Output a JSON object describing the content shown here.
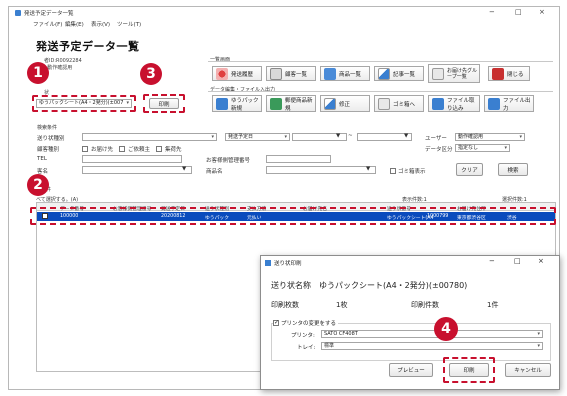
{
  "window": {
    "title": "発送予定データ一覧",
    "minimize": "−",
    "maximize": "□",
    "close": "×"
  },
  "menu": [
    "ファイル(F)",
    "編集(E)",
    "表示(V)",
    "ツール(T)"
  ],
  "page_title": "発送予定データ一覧",
  "user_info": {
    "line1": "者ID:R0092284",
    "line2": ": 動作確認用"
  },
  "invoice_select": {
    "caption": "状",
    "value": "ゆうパックシート(A4・2発分)(±007"
  },
  "print_button": "印刷",
  "list_screen": {
    "caption": "一覧画面",
    "buttons": [
      "発送履歴",
      "顧客一覧",
      "商品一覧",
      "記事一覧",
      "お届け先グループ一覧",
      "閉じる"
    ]
  },
  "data_edit": {
    "caption": "データ編集・ファイル入出力",
    "buttons": [
      "ゆうパック新規",
      "郵便商品新規",
      "修正",
      "ゴミ箱へ",
      "ファイル取り込み",
      "ファイル出力"
    ]
  },
  "search": {
    "caption": "検索条件",
    "invoice_type_label": "送り状種別",
    "date_label": "発送予定日",
    "tilde": "~",
    "user_label": "ユーザー",
    "user_value": "動作確認用",
    "customer_type_label": "顧客種別",
    "checks": [
      "お届け先",
      "ご依頼主",
      "集荷先"
    ],
    "data_class_label": "データ区分",
    "data_class_value": "指定なし",
    "tel_label": "TEL",
    "mgmt_no_label": "お客様側管理番号",
    "name_label": "客名",
    "product_label": "商品名",
    "trash_check": "ゴミ箱表示",
    "clear_button": "クリア",
    "search_button": "検索"
  },
  "results": {
    "caption": "送条件",
    "select_all": "べて選択する。(A)",
    "display_count": "表示件数:1",
    "selected_count": "選択件数:1",
    "headers": [
      "データ番号",
      "お客様側管理番号",
      "発送予定日",
      "送り状種別",
      "支払方法",
      "お届け先名",
      "送り状番号",
      "お届け先住所"
    ],
    "row": [
      "100000",
      "",
      "20200812",
      "ゆうパック",
      "元払い",
      "",
      "ゆうパックシート(A4",
      "1000799",
      "東京都渋谷区",
      "渋谷"
    ]
  },
  "dialog": {
    "title": "送り状印刷",
    "name_label": "送り状名称",
    "name_value": "ゆうパックシート(A4・2発分)(±00780)",
    "count_label": "印刷枚数",
    "count_value": "1枚",
    "items_label": "印刷件数",
    "items_value": "1件",
    "printer_change": "プリンタの変更をする",
    "printer_label": "プリンタ:",
    "printer_value": "SATO CF408T",
    "tray_label": "トレイ:",
    "tray_value": "標準",
    "preview_button": "プレビュー",
    "print_button": "印刷",
    "cancel_button": "キャンセル"
  },
  "badges": [
    "1",
    "2",
    "3",
    "4"
  ],
  "colors": {
    "accent_red": "#c8102e",
    "selection_blue": "#0a4bbd"
  }
}
